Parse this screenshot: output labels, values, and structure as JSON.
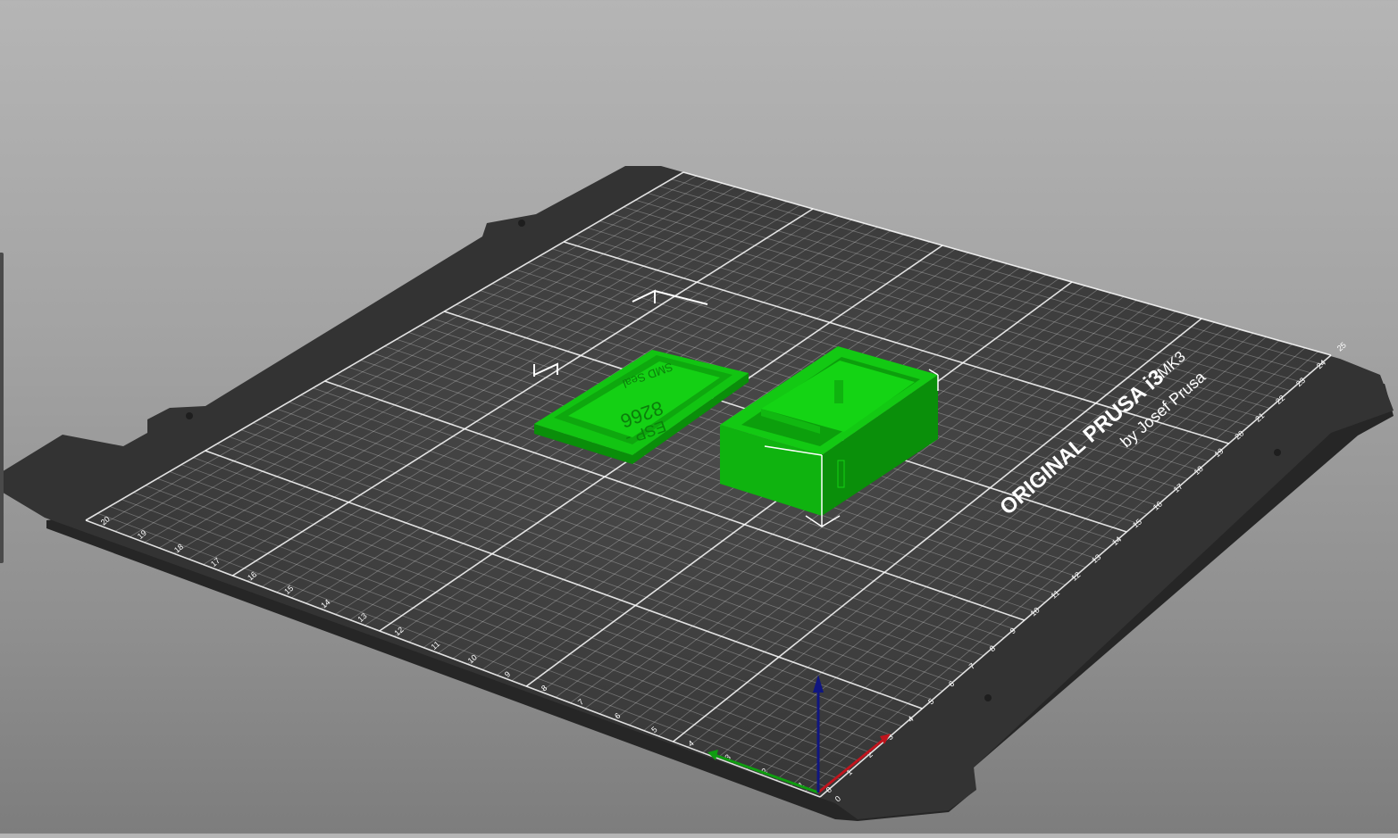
{
  "viewport": {
    "background_top": "#b5b5b5",
    "background_bottom": "#7d7d7d"
  },
  "bed": {
    "plate_color": "#333333",
    "surface_color": "#3a3a3a",
    "grid_color": "#ffffff",
    "logo_text": "ORIGINAL PRUSA i3",
    "logo_model": "MK3",
    "logo_sub": "by Josef Prusa",
    "y_ruler_labels": [
      "0",
      "1",
      "2",
      "3",
      "4",
      "5",
      "6",
      "7",
      "8",
      "9",
      "10",
      "11",
      "12",
      "13",
      "14",
      "15",
      "16",
      "17",
      "18",
      "19",
      "20",
      "21",
      "22",
      "23",
      "24",
      "25"
    ],
    "x_ruler_labels": [
      "20",
      "19",
      "18",
      "17",
      "16",
      "15",
      "14",
      "13",
      "12",
      "11",
      "10",
      "9",
      "8",
      "7",
      "6",
      "5",
      "4",
      "3",
      "2",
      "1",
      "0"
    ]
  },
  "objects": {
    "color": "#11c511",
    "lid_text_line1": "ESP -",
    "lid_text_line2": "8266",
    "lid_text_line3": "SMD Seal"
  },
  "axes": {
    "x_color": "#c0141d",
    "y_color": "#0f9d10",
    "z_color": "#101680"
  }
}
